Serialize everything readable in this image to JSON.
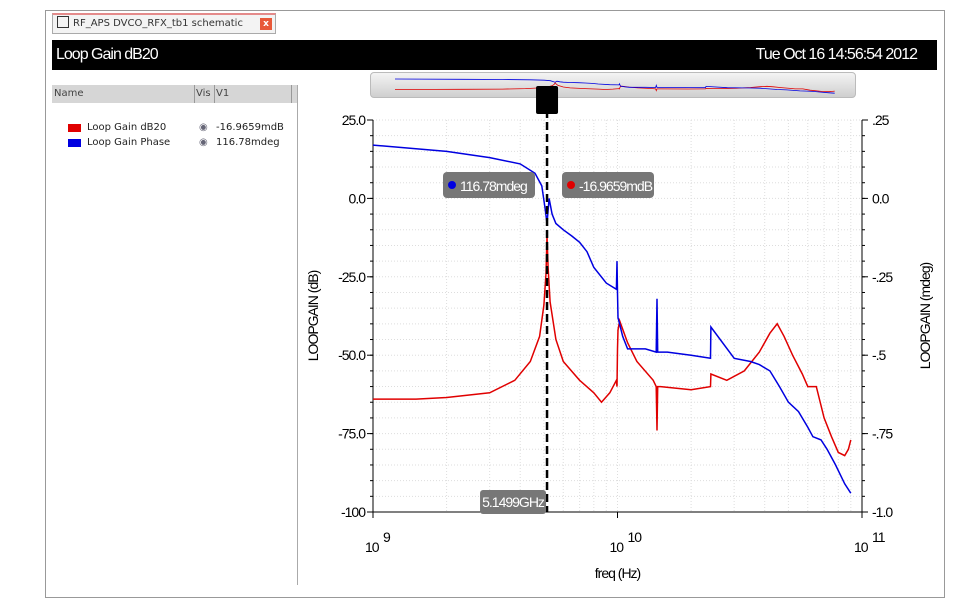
{
  "tab": {
    "title": "RF_APS DVCO_RFX_tb1 schematic",
    "close": "x"
  },
  "header": {
    "title": "Loop Gain dB20",
    "timestamp": "Tue Oct 16 14:56:54 2012"
  },
  "legend": {
    "columns": [
      "Name",
      "Vis",
      "V1"
    ],
    "items": [
      {
        "name": "Loop Gain dB20",
        "value": "-16.9659mdB",
        "color": "#e00000"
      },
      {
        "name": "Loop Gain Phase",
        "value": "116.78mdeg",
        "color": "#0000e0"
      }
    ]
  },
  "marker": {
    "label": "V1",
    "x_label": "5.1499GHz",
    "phase_label": "116.78mdeg",
    "gain_label": "-16.9659mdB"
  },
  "chart_data": {
    "type": "line",
    "xlabel": "freq (Hz)",
    "ylabel": "LOOPGAIN (dB)",
    "y2label": "LOOPGAIN (mdeg)",
    "xscale": "log",
    "xlim": [
      1000000000.0,
      100000000000.0
    ],
    "ylim": [
      -100,
      25
    ],
    "y2lim": [
      -1.0,
      0.25
    ],
    "xticks": [
      {
        "base": "10",
        "exp": "9"
      },
      {
        "base": "10",
        "exp": "10"
      },
      {
        "base": "10",
        "exp": "11"
      }
    ],
    "yticks": [
      "25.0",
      "0.0",
      "-25.0",
      "-50.0",
      "-75.0",
      "-100"
    ],
    "y2ticks": [
      ".25",
      "0.0",
      "-.25",
      "-.5",
      "-.75",
      "-1.0"
    ],
    "grid": true,
    "series": [
      {
        "name": "Loop Gain dB20",
        "axis": "left",
        "color": "#e00000",
        "x_ghz": [
          1,
          1.5,
          2,
          3,
          3.8,
          4.4,
          4.8,
          5.0,
          5.1,
          5.15,
          5.2,
          5.3,
          5.6,
          6,
          7,
          8,
          8.6,
          9.3,
          9.9,
          9.95,
          10,
          10.05,
          10.2,
          11,
          12,
          14,
          14.4,
          14.5,
          14.6,
          15,
          20,
          24,
          24.1,
          28,
          33,
          38,
          42,
          45,
          48,
          52,
          57,
          60,
          65,
          70,
          75,
          80,
          85,
          88,
          90
        ],
        "y": [
          -64,
          -64,
          -63.5,
          -62,
          -58,
          -52,
          -44,
          -34,
          -24,
          -12,
          -22,
          -33,
          -45,
          -52,
          -58,
          -62,
          -65,
          -62,
          -58,
          -60,
          -48,
          -42,
          -39,
          -46,
          -52,
          -58,
          -60,
          -74,
          -60,
          -60,
          -61,
          -60,
          -56,
          -58,
          -55,
          -49,
          -43,
          -40,
          -44,
          -50,
          -56,
          -60,
          -60,
          -70,
          -76,
          -81,
          -82,
          -80,
          -77
        ]
      },
      {
        "name": "Loop Gain Phase",
        "axis": "right",
        "color": "#0000e0",
        "x_ghz": [
          1,
          2,
          3,
          4,
          4.6,
          4.9,
          5.05,
          5.15,
          5.25,
          5.4,
          5.6,
          6,
          6.5,
          7,
          7.5,
          8,
          9,
          9.9,
          9.95,
          10,
          10.05,
          10.5,
          11,
          13,
          14.4,
          14.5,
          14.6,
          16,
          20,
          24,
          24.1,
          30,
          35,
          38,
          42,
          46,
          50,
          55,
          60,
          63,
          68,
          72,
          78,
          85,
          90
        ],
        "y": [
          0.17,
          0.15,
          0.13,
          0.11,
          0.08,
          0.04,
          -0.03,
          -0.08,
          0.0,
          -0.05,
          -0.08,
          -0.1,
          -0.12,
          -0.14,
          -0.17,
          -0.22,
          -0.27,
          -0.29,
          -0.2,
          -0.3,
          -0.38,
          -0.44,
          -0.48,
          -0.48,
          -0.49,
          -0.32,
          -0.49,
          -0.49,
          -0.5,
          -0.51,
          -0.41,
          -0.51,
          -0.52,
          -0.53,
          -0.55,
          -0.6,
          -0.65,
          -0.68,
          -0.73,
          -0.76,
          -0.77,
          -0.8,
          -0.85,
          -0.91,
          -0.94
        ]
      }
    ]
  }
}
